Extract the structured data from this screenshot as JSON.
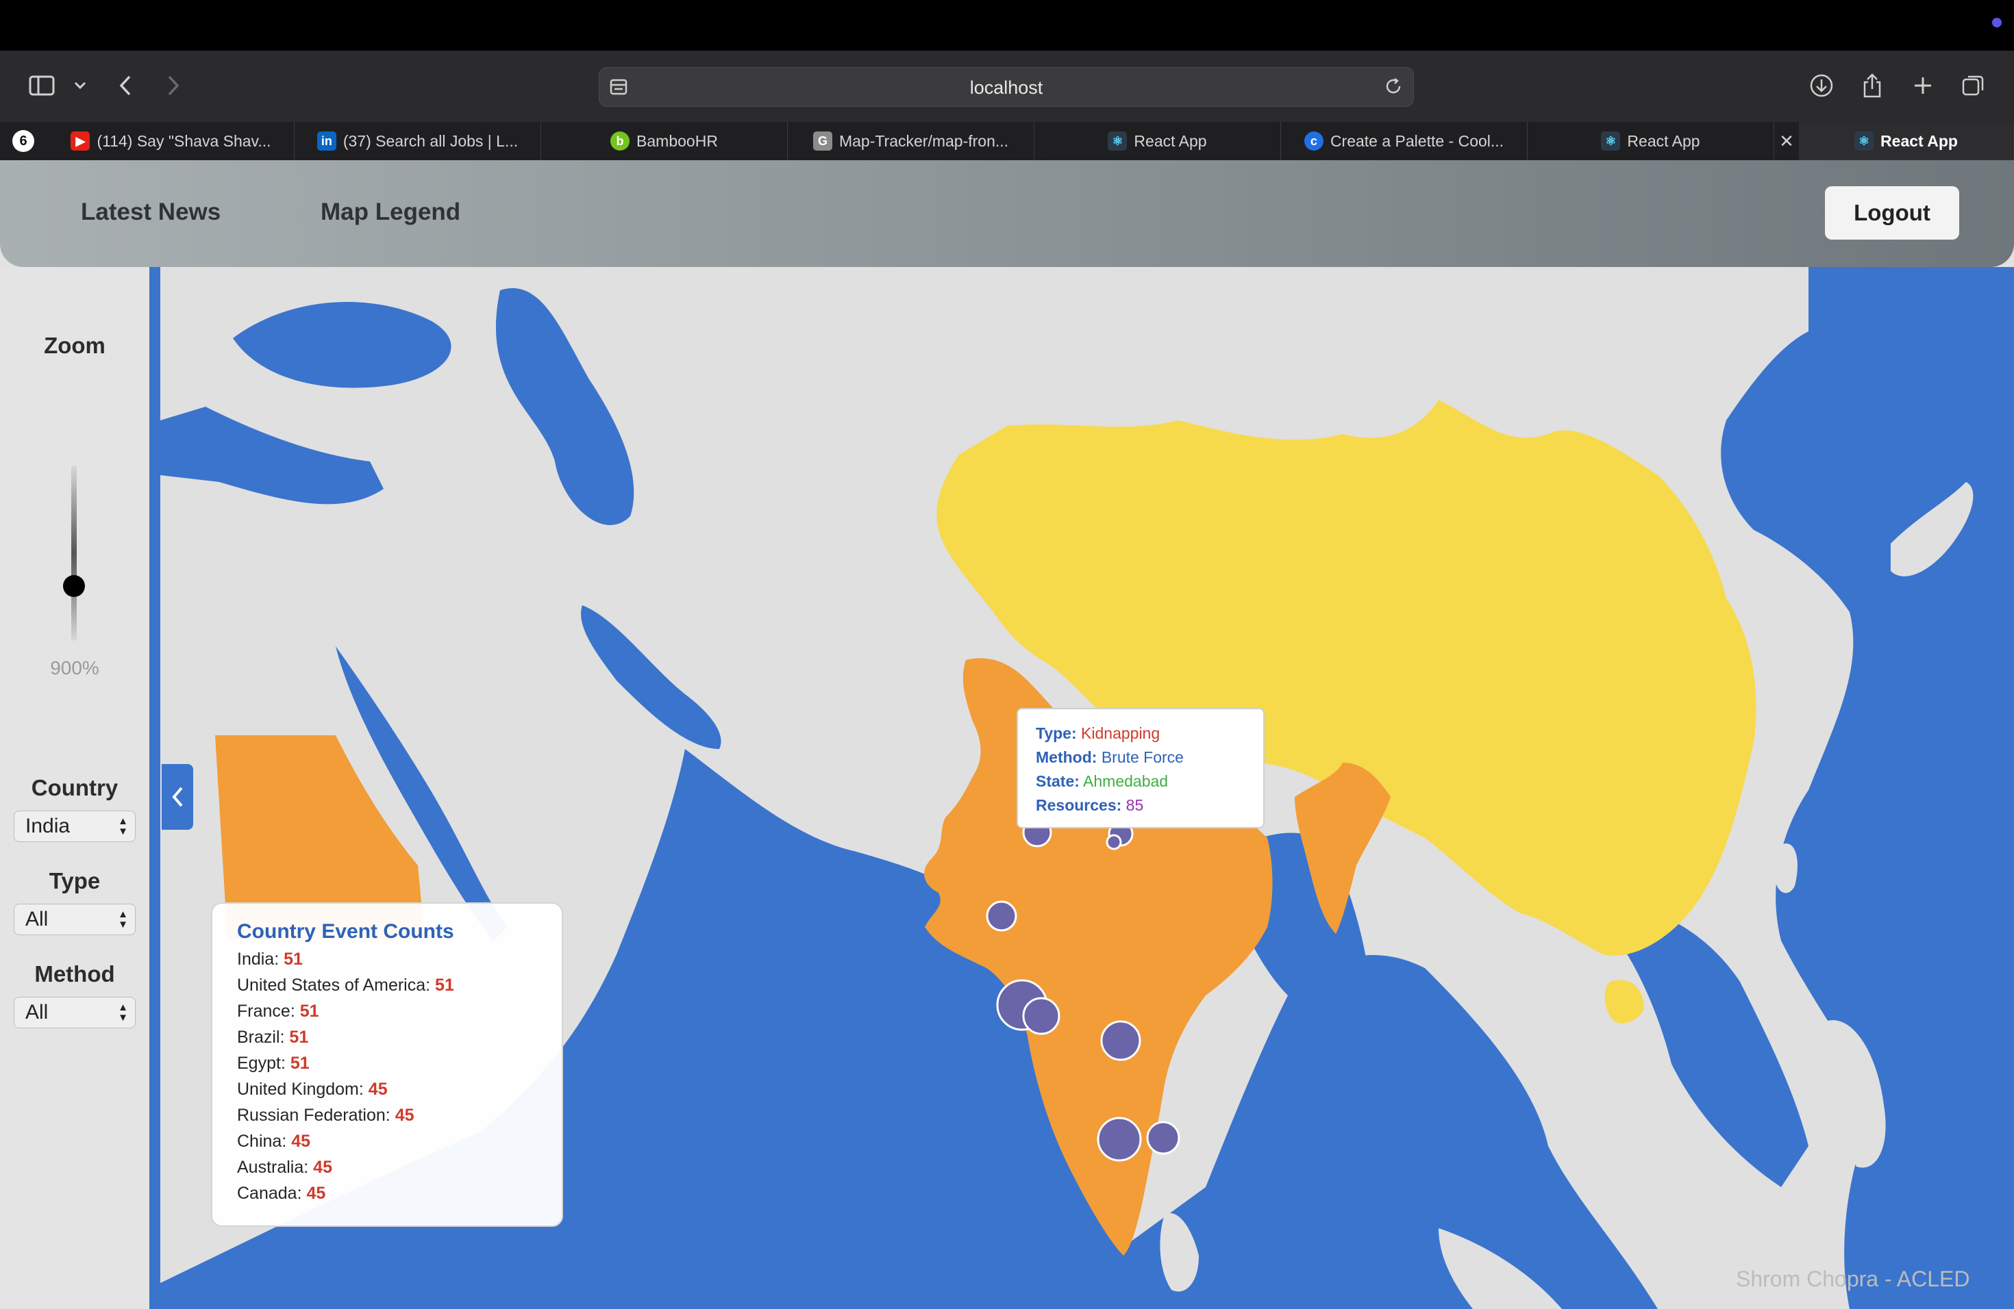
{
  "browser": {
    "url": "localhost",
    "tabs": [
      {
        "label": "(114) Say \"Shava Shav...",
        "icon": "youtube-icon",
        "color": "#e62117"
      },
      {
        "label": "(37) Search all Jobs | L...",
        "icon": "linkedin-icon",
        "color": "#0a66c2"
      },
      {
        "label": "BambooHR",
        "icon": "bamboohr-icon",
        "color": "#73c41d"
      },
      {
        "label": "Map-Tracker/map-fron...",
        "icon": "g-icon",
        "color": "#8b8b8b"
      },
      {
        "label": "React App",
        "icon": "react-icon",
        "color": "#61dafb"
      },
      {
        "label": "Create a Palette - Cool...",
        "icon": "coolors-icon",
        "color": "#1f6fe5"
      },
      {
        "label": "React App",
        "icon": "react-icon",
        "color": "#61dafb"
      },
      {
        "label": "React App",
        "icon": "react-icon",
        "color": "#61dafb",
        "active": true
      }
    ]
  },
  "header": {
    "nav": [
      "Latest News",
      "Map Legend"
    ],
    "logout": "Logout"
  },
  "sidebar": {
    "zoom_label": "Zoom",
    "zoom_value": "900%",
    "zoom_level": 0.3,
    "country_label": "Country",
    "country_value": "India",
    "type_label": "Type",
    "type_value": "All",
    "method_label": "Method",
    "method_value": "All"
  },
  "tooltip": {
    "type_label": "Type:",
    "type_value": "Kidnapping",
    "type_color": "#d03a2a",
    "method_label": "Method:",
    "method_value": "Brute Force",
    "method_color": "#2e62b8",
    "state_label": "State:",
    "state_value": "Ahmedabad",
    "state_color": "#3fae3f",
    "resources_label": "Resources:",
    "resources_value": "85",
    "resources_color": "#9b2fae"
  },
  "counts": {
    "title": "Country Event Counts",
    "rows": [
      {
        "country": "India",
        "count": "51"
      },
      {
        "country": "United States of America",
        "count": "51"
      },
      {
        "country": "France",
        "count": "51"
      },
      {
        "country": "Brazil",
        "count": "51"
      },
      {
        "country": "Egypt",
        "count": "51"
      },
      {
        "country": "United Kingdom",
        "count": "45"
      },
      {
        "country": "Russian Federation",
        "count": "45"
      },
      {
        "country": "China",
        "count": "45"
      },
      {
        "country": "Australia",
        "count": "45"
      },
      {
        "country": "Canada",
        "count": "45"
      }
    ]
  },
  "map": {
    "colors": {
      "ocean": "#3a74cd",
      "land": "#e0e0e0",
      "highlight_orange": "#f29d38",
      "highlight_yellow": "#f7d94c",
      "marker": "#6a64a8"
    }
  },
  "watermark": "Shrom Chopra - ACLED"
}
